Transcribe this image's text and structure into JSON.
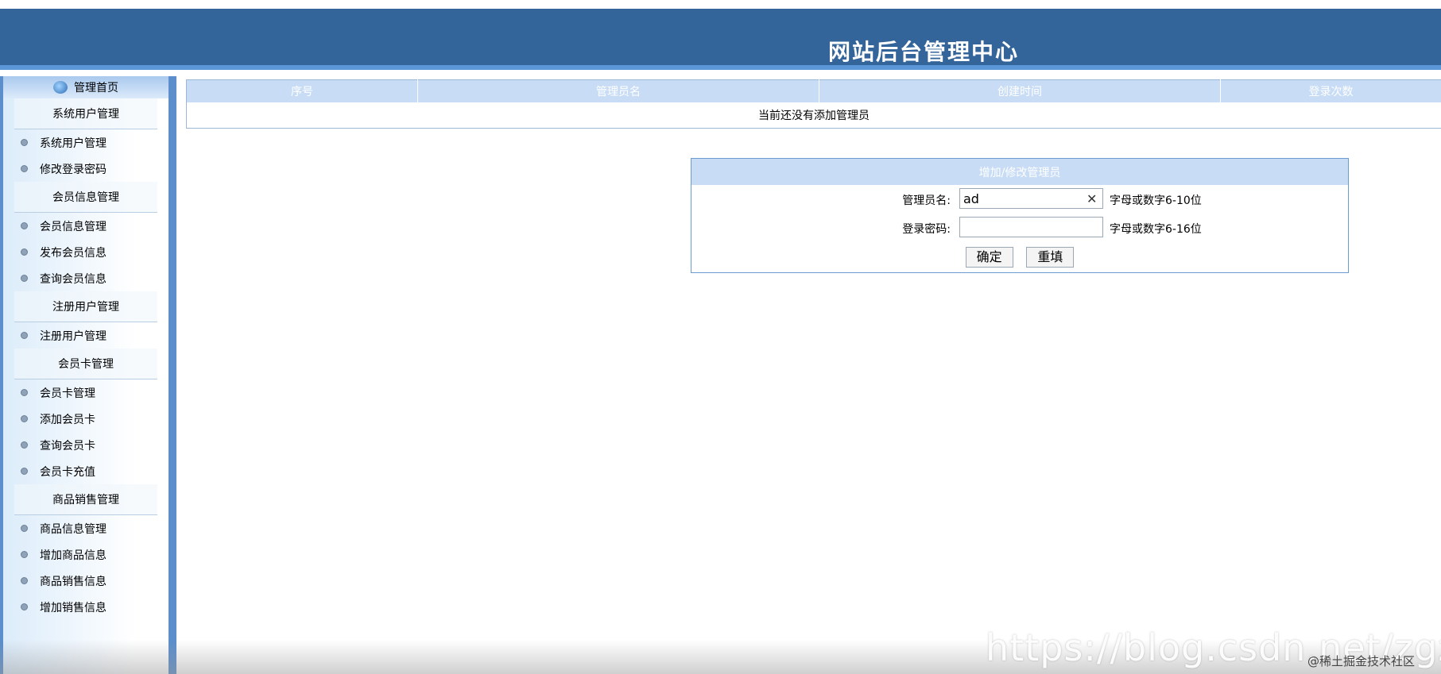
{
  "header": {
    "title": "网站后台管理中心"
  },
  "sidebar": {
    "home_label": "管理首页",
    "groups": [
      {
        "title": "系统用户管理",
        "items": [
          "系统用户管理",
          "修改登录密码"
        ]
      },
      {
        "title": "会员信息管理",
        "items": [
          "会员信息管理",
          "发布会员信息",
          "查询会员信息"
        ]
      },
      {
        "title": "注册用户管理",
        "items": [
          "注册用户管理"
        ]
      },
      {
        "title": "会员卡管理",
        "items": [
          "会员卡管理",
          "添加会员卡",
          "查询会员卡",
          "会员卡充值"
        ]
      },
      {
        "title": "商品销售管理",
        "items": [
          "商品信息管理",
          "增加商品信息",
          "商品销售信息",
          "增加销售信息"
        ]
      }
    ]
  },
  "admin_table": {
    "headers": [
      "序号",
      "管理员名",
      "创建时间",
      "登录次数"
    ],
    "empty_message": "当前还没有添加管理员"
  },
  "form": {
    "title": "增加/修改管理员",
    "name_label": "管理员名:",
    "name_value": "ad",
    "name_hint": "字母或数字6-10位",
    "password_label": "登录密码:",
    "password_value": "",
    "password_hint": "字母或数字6-16位",
    "confirm_label": "确定",
    "reset_label": "重填"
  },
  "watermark": {
    "url": "https://blog.csdn.net/zgz",
    "site": "@稀土掘金技术社区"
  }
}
